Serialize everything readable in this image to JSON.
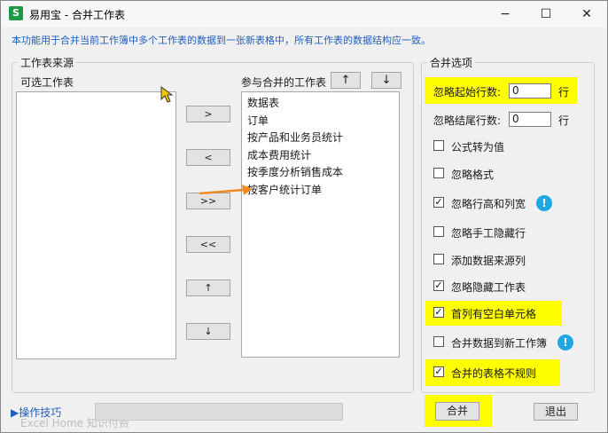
{
  "window": {
    "app_icon": "S",
    "title": "易用宝 - 合并工作表",
    "minimize": "−",
    "maximize": "☐",
    "close": "✕"
  },
  "description": "本功能用于合并当前工作簿中多个工作表的数据到一张新表格中，所有工作表的数据结构应一致。",
  "source_group": {
    "legend": "工作表来源",
    "available_label": "可选工作表",
    "merge_label": "参与合并的工作表",
    "up_button": "↑",
    "down_button": "↓",
    "available_sheets": [],
    "merge_sheets": [
      "数据表",
      "订单",
      "按产品和业务员统计",
      "成本费用统计",
      "按季度分析销售成本",
      "按客户统计订单"
    ],
    "transfer_buttons": [
      ">",
      "<",
      ">>",
      "<<",
      "↑",
      "↓"
    ]
  },
  "options_group": {
    "legend": "合并选项",
    "skip_start_rows": {
      "label": "忽略起始行数:",
      "value": "0",
      "unit": "行"
    },
    "skip_end_rows": {
      "label": "忽略结尾行数:",
      "value": "0",
      "unit": "行"
    },
    "checkboxes": [
      {
        "label": "公式转为值",
        "checked": false
      },
      {
        "label": "忽略格式",
        "checked": false
      },
      {
        "label": "忽略行高和列宽",
        "checked": true
      },
      {
        "label": "忽略手工隐藏行",
        "checked": false
      },
      {
        "label": "添加数据来源列",
        "checked": false
      },
      {
        "label": "忽略隐藏工作表",
        "checked": true
      },
      {
        "label": "首列有空白单元格",
        "checked": true
      },
      {
        "label": "合并数据到新工作簿",
        "checked": false
      },
      {
        "label": "合并的表格不规则",
        "checked": true
      }
    ],
    "info_icon": "!"
  },
  "footer": {
    "tips_link": "▶操作技巧",
    "watermark": "Excel Home 知识付费",
    "merge_button": "合并",
    "exit_button": "退出"
  },
  "colors": {
    "highlight": "#ffff00",
    "link": "#1f5fbf",
    "info": "#1ea7e0",
    "annotation_arrow": "#f08a24",
    "app_icon": "#1e9a44"
  }
}
